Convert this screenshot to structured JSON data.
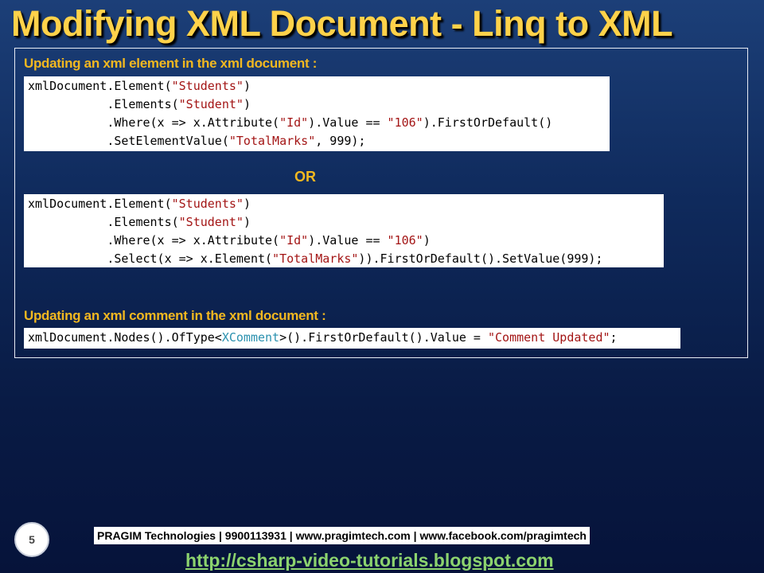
{
  "slide": {
    "title": "Modifying XML Document - Linq to XML",
    "slide_number": "5"
  },
  "section1": {
    "heading": "Updating an xml element in the xml document :",
    "code_block_a": {
      "l1_a": "xmlDocument.Element(",
      "l1_s": "\"Students\"",
      "l1_b": ")",
      "l2_a": "           .Elements(",
      "l2_s": "\"Student\"",
      "l2_b": ")",
      "l3_a": "           .Where(x => x.Attribute(",
      "l3_s1": "\"Id\"",
      "l3_b": ").Value == ",
      "l3_s2": "\"106\"",
      "l3_c": ").FirstOrDefault()",
      "l4_a": "           .SetElementValue(",
      "l4_s": "\"TotalMarks\"",
      "l4_b": ", 999);"
    },
    "or_label": "OR",
    "code_block_b": {
      "l1_a": "xmlDocument.Element(",
      "l1_s": "\"Students\"",
      "l1_b": ")",
      "l2_a": "           .Elements(",
      "l2_s": "\"Student\"",
      "l2_b": ")",
      "l3_a": "           .Where(x => x.Attribute(",
      "l3_s1": "\"Id\"",
      "l3_b": ").Value == ",
      "l3_s2": "\"106\"",
      "l3_c": ")",
      "l4_a": "           .Select(x => x.Element(",
      "l4_s": "\"TotalMarks\"",
      "l4_b": ")).FirstOrDefault().SetValue(999);"
    }
  },
  "section2": {
    "heading": "Updating an xml comment in the xml document :",
    "code_block_c": {
      "l1_a": "xmlDocument.Nodes().OfType<",
      "l1_t": "XComment",
      "l1_b": ">().FirstOrDefault().Value = ",
      "l1_s": "\"Comment Updated\"",
      "l1_c": ";"
    }
  },
  "footer": {
    "info_bar": "PRAGIM Technologies | 9900113931 | www.pragimtech.com | www.facebook.com/pragimtech",
    "blog_link": "http://csharp-video-tutorials.blogspot.com"
  },
  "colors": {
    "title": "#ffd24a",
    "heading": "#f2b820",
    "code_string": "#a31515",
    "code_type": "#2b91af",
    "link": "#8cd36e"
  }
}
